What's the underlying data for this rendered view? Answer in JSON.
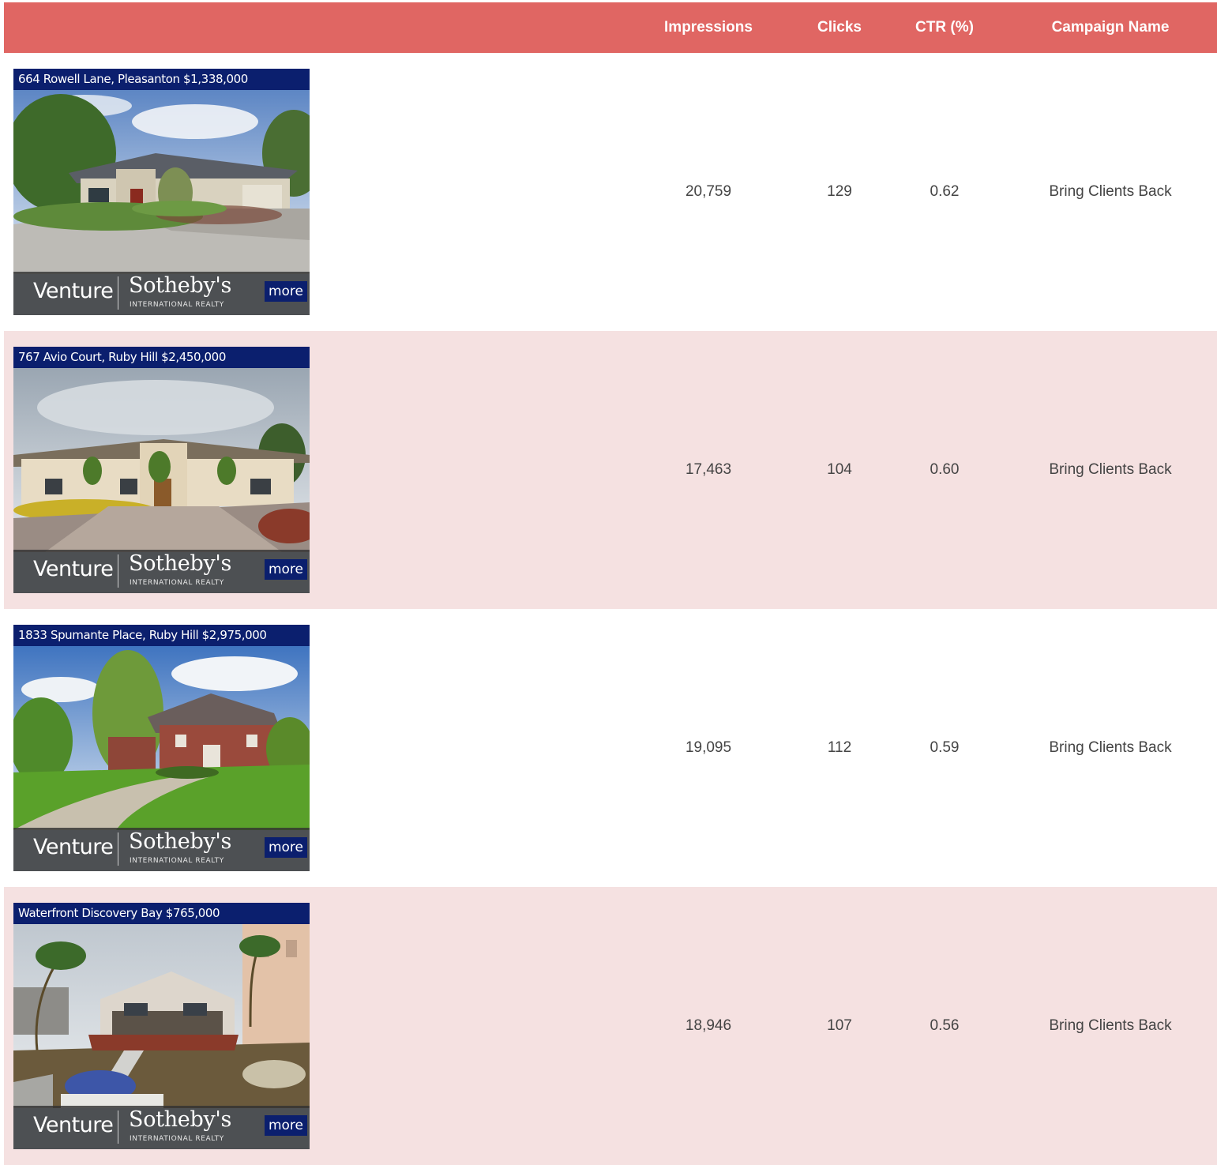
{
  "table": {
    "headers": {
      "impressions": "Impressions",
      "clicks": "Clicks",
      "ctr": "CTR (%)",
      "campaign": "Campaign Name"
    },
    "rows": [
      {
        "ad": {
          "title": "664 Rowell Lane, Pleasanton $1,338,000",
          "brand_left": "Venture",
          "brand_right": "Sotheby's",
          "brand_sub": "INTERNATIONAL REALTY",
          "more_label": "more"
        },
        "impressions": "20,759",
        "clicks": "129",
        "ctr": "0.62",
        "campaign": "Bring Clients Back"
      },
      {
        "ad": {
          "title": "767 Avio Court, Ruby Hill $2,450,000",
          "brand_left": "Venture",
          "brand_right": "Sotheby's",
          "brand_sub": "INTERNATIONAL REALTY",
          "more_label": "more"
        },
        "impressions": "17,463",
        "clicks": "104",
        "ctr": "0.60",
        "campaign": "Bring Clients Back"
      },
      {
        "ad": {
          "title": "1833 Spumante Place, Ruby Hill $2,975,000",
          "brand_left": "Venture",
          "brand_right": "Sotheby's",
          "brand_sub": "INTERNATIONAL REALTY",
          "more_label": "more"
        },
        "impressions": "19,095",
        "clicks": "112",
        "ctr": "0.59",
        "campaign": "Bring Clients Back"
      },
      {
        "ad": {
          "title": "Waterfront Discovery Bay $765,000",
          "brand_left": "Venture",
          "brand_right": "Sotheby's",
          "brand_sub": "INTERNATIONAL REALTY",
          "more_label": "more"
        },
        "impressions": "18,946",
        "clicks": "107",
        "ctr": "0.56",
        "campaign": "Bring Clients Back"
      }
    ]
  },
  "colors": {
    "header_bg": "#e06663",
    "alt_row_bg": "#f5e1e1",
    "ad_bar": "#0b1f6e"
  }
}
